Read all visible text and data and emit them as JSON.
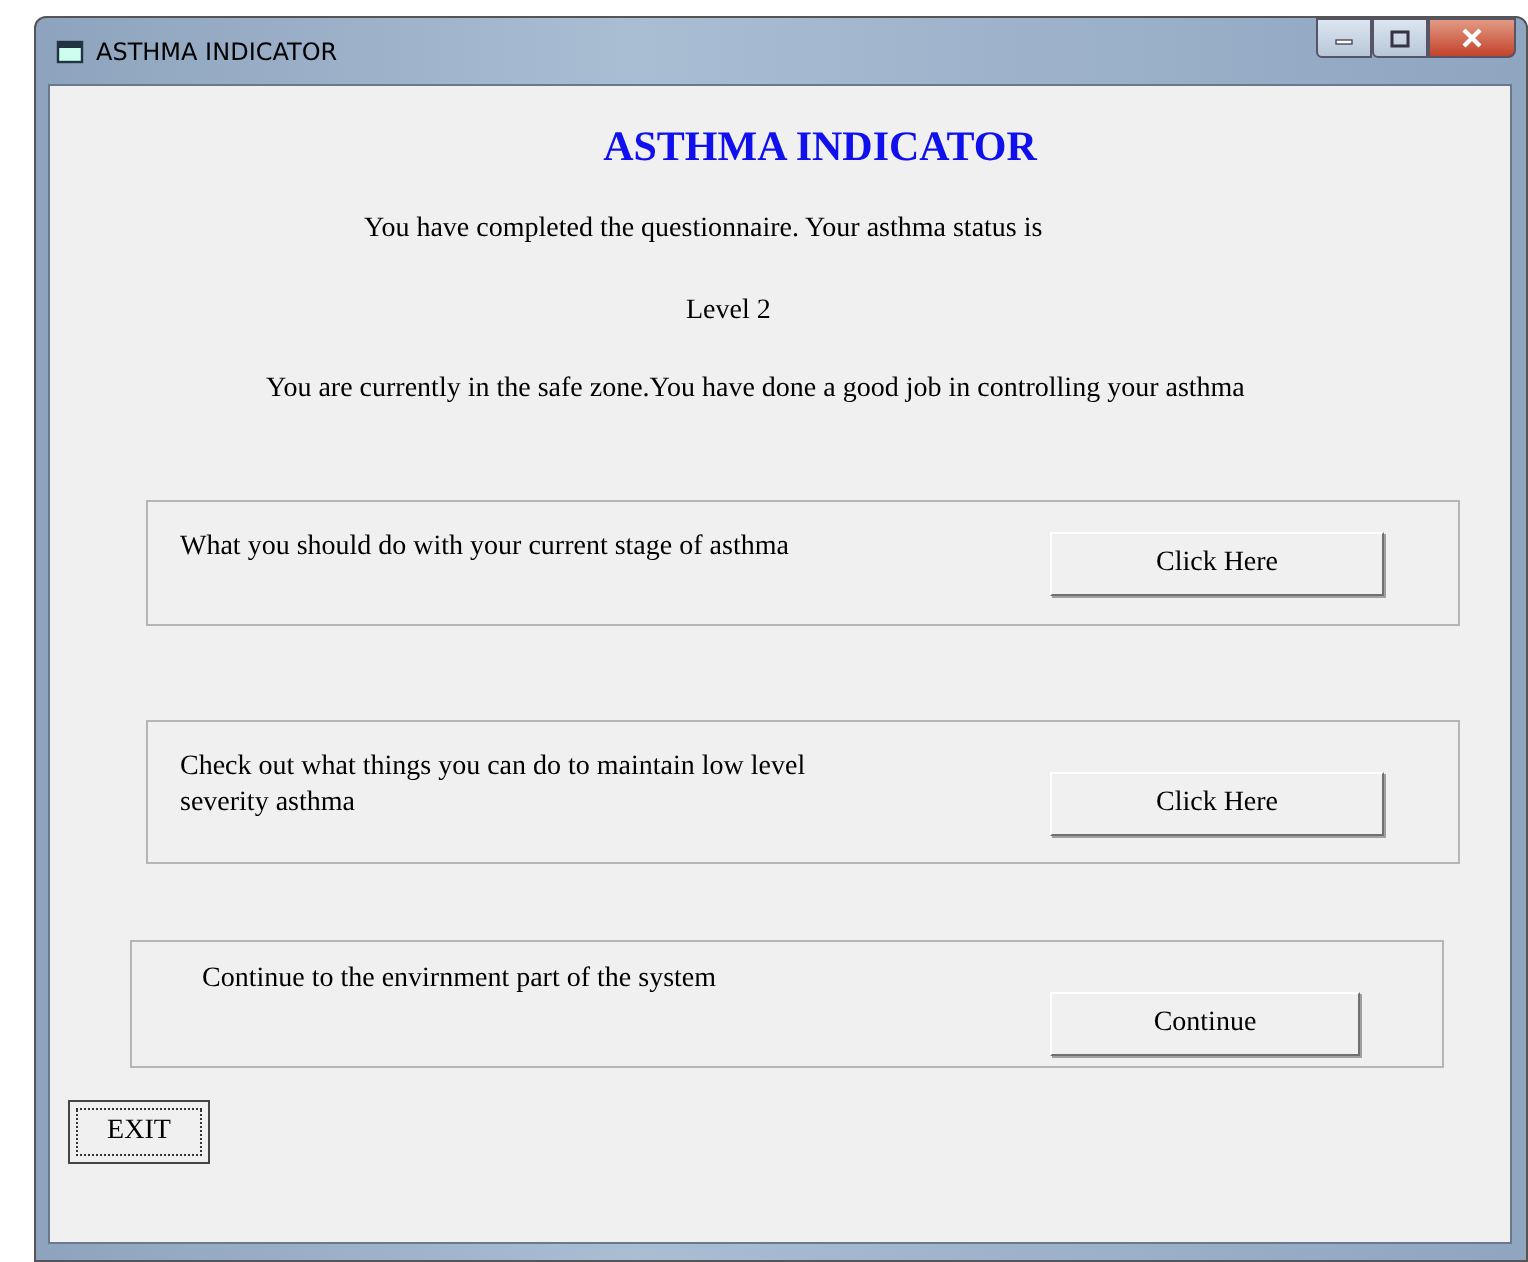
{
  "window": {
    "title": "ASTHMA INDICATOR"
  },
  "heading": "ASTHMA INDICATOR",
  "intro": "You have completed the questionnaire. Your asthma status is",
  "level_text": "Level 2",
  "zone_text": "You are currently in the safe zone.You have done a good job in controlling your asthma",
  "panels": [
    {
      "text": "What you should do with your current stage of asthma",
      "button": "Click Here"
    },
    {
      "text": "Check out what things you can do to maintain low level severity asthma",
      "button": "Click Here"
    },
    {
      "text": "Continue to the envirnment part of the system",
      "button": "Continue"
    }
  ],
  "exit_button": {
    "label": "EXIT",
    "focused": true
  }
}
